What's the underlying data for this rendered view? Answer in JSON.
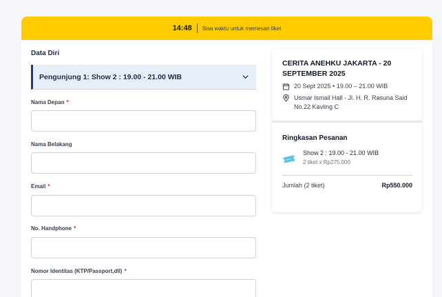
{
  "timer": {
    "time": "14:48",
    "text": "Sisa waktu untuk memesan tiket"
  },
  "form": {
    "section_title": "Data Diri",
    "visitor_label": "Pengunjung 1: Show 2 : 19.00 - 21.00 WIB",
    "fields": [
      {
        "label": "Nama Depan",
        "required": "*",
        "value": "",
        "placeholder": ""
      },
      {
        "label": "Nama Belakang",
        "required": "",
        "value": "",
        "placeholder": ""
      },
      {
        "label": "Email",
        "required": "*",
        "value": "",
        "placeholder": ""
      },
      {
        "label": "No. Handphone",
        "required": "*",
        "value": "",
        "placeholder": ""
      },
      {
        "label": "Nomor Identitas (KTP/Passport,dll)",
        "required": "*",
        "value": "",
        "placeholder": ""
      }
    ]
  },
  "event": {
    "title": "CERITA ANEHKU JAKARTA - 20 SEPTEMBER 2025",
    "date": "20 Sept 2025 • 19.00 – 21.00 WIB",
    "venue": "Usmar Ismail Hall - Jl. H. R. Rasuna Said No.22 Kavling C",
    "icons": [
      "calendar-icon",
      "location-pin-icon"
    ]
  },
  "summary": {
    "title": "Ringkasan Pesanan",
    "show": "Show 2 : 19.00 - 21.00 WIB",
    "quantity": "2 tiket x Rp275.000",
    "total_label": "Jumlah (2 tiket)",
    "total_value": "Rp550.000",
    "icon": "ticket-icon"
  },
  "colors": {
    "accent": "#ffcc00",
    "navy": "#1e3a6e",
    "panel": "#e8eef8",
    "required": "#dc2626",
    "ticket": "#5bc4dc"
  }
}
